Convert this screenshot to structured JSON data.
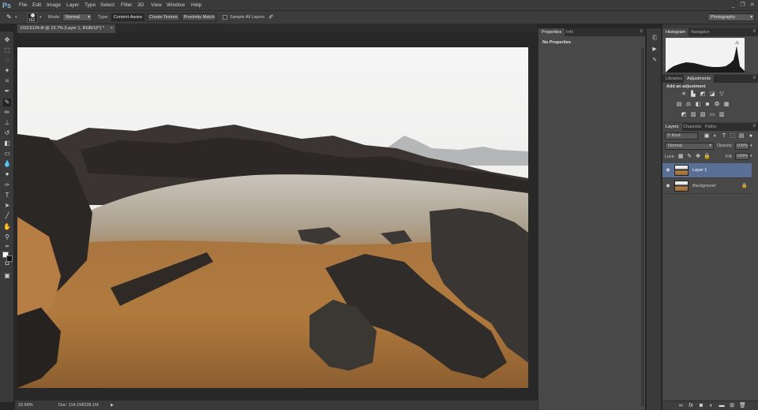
{
  "app": {
    "logo": "Ps"
  },
  "menu": [
    "File",
    "Edit",
    "Image",
    "Layer",
    "Type",
    "Select",
    "Filter",
    "3D",
    "View",
    "Window",
    "Help"
  ],
  "options": {
    "brush_size": "162",
    "mode_label": "Mode:",
    "mode_value": "Normal",
    "type_label": "Type:",
    "type_content_aware": "Content-Aware",
    "type_create_texture": "Create Texture",
    "type_proximity_match": "Proximity Match",
    "sample_all_layers": "Sample All Layers",
    "workspace": "Photography"
  },
  "document": {
    "tab_title": "DSC6124.tif @ 23.7% (Layer 1, RGB/16*) *",
    "zoom": "23.68%",
    "doc_size": "Doc: 114.1M/228.1M"
  },
  "properties_panel": {
    "tabs": [
      "Properties",
      "Info"
    ],
    "message": "No Properties"
  },
  "histogram_panel": {
    "tabs": [
      "Histogram",
      "Navigator"
    ]
  },
  "adjustments_panel": {
    "tabs": [
      "Libraries",
      "Adjustments"
    ],
    "heading": "Add an adjustment"
  },
  "layers_panel": {
    "tabs": [
      "Layers",
      "Channels",
      "Paths"
    ],
    "filter_kind": "Kind",
    "blend_mode": "Normal",
    "opacity_label": "Opacity:",
    "opacity_value": "100%",
    "lock_label": "Lock:",
    "fill_label": "Fill:",
    "fill_value": "100%",
    "layers": [
      {
        "name": "Layer 1",
        "selected": true
      },
      {
        "name": "Background",
        "selected": false
      }
    ],
    "footer_fx": "fx"
  },
  "colors": {
    "accent": "#5a6f96",
    "panel": "#484848",
    "canvas_bg": "#282828"
  }
}
